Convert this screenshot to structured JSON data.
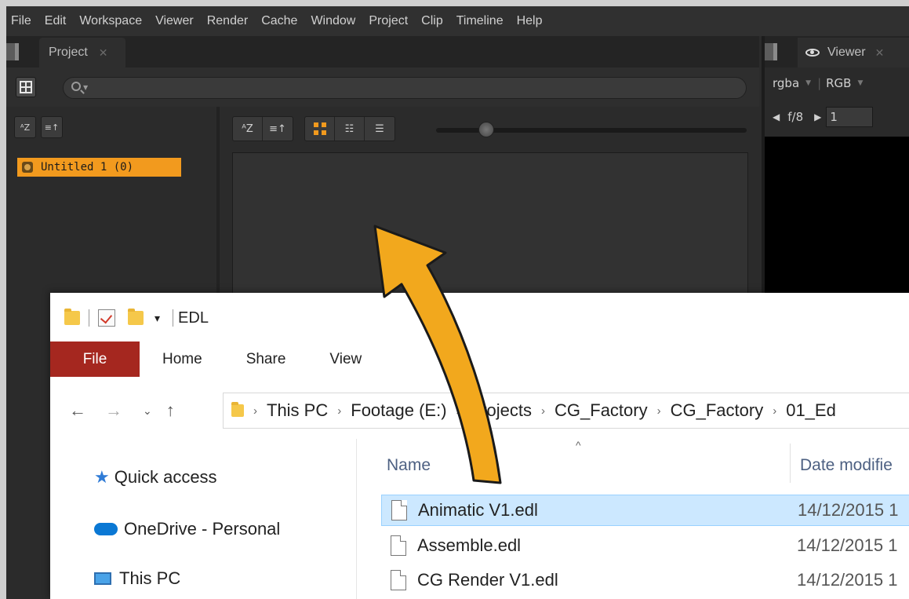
{
  "menu": [
    "File",
    "Edit",
    "Workspace",
    "Viewer",
    "Render",
    "Cache",
    "Window",
    "Project",
    "Clip",
    "Timeline",
    "Help"
  ],
  "project_tab": {
    "label": "Project",
    "close": "✕"
  },
  "sort_left": {
    "az": "ᴬZ",
    "sort": "≡↑"
  },
  "bin_item": "Untitled 1 (0)",
  "viewer": {
    "tab_label": "Viewer",
    "tab_close": "✕",
    "channels": "rgba",
    "colorspace": "RGB",
    "fstop": "f/8",
    "frame": "1"
  },
  "explorer": {
    "title": "EDL",
    "ribbon": {
      "file": "File",
      "home": "Home",
      "share": "Share",
      "view": "View"
    },
    "path": [
      "This PC",
      "Footage (E:)",
      "Projects",
      "CG_Factory",
      "CG_Factory",
      "01_Ed"
    ],
    "nav": {
      "quick_access": "Quick access",
      "onedrive": "OneDrive - Personal",
      "this_pc": "This PC"
    },
    "columns": {
      "name": "Name",
      "date": "Date modifie"
    },
    "files": [
      {
        "name": "Animatic V1.edl",
        "date": "14/12/2015 1",
        "selected": true
      },
      {
        "name": "Assemble.edl",
        "date": "14/12/2015 1",
        "selected": false
      },
      {
        "name": "CG Render V1.edl",
        "date": "14/12/2015 1",
        "selected": false
      }
    ]
  },
  "colors": {
    "accent": "#f29a1e",
    "nuke_bg": "#2b2b2b",
    "file_tab": "#a5271f",
    "selection": "#cce8ff"
  }
}
